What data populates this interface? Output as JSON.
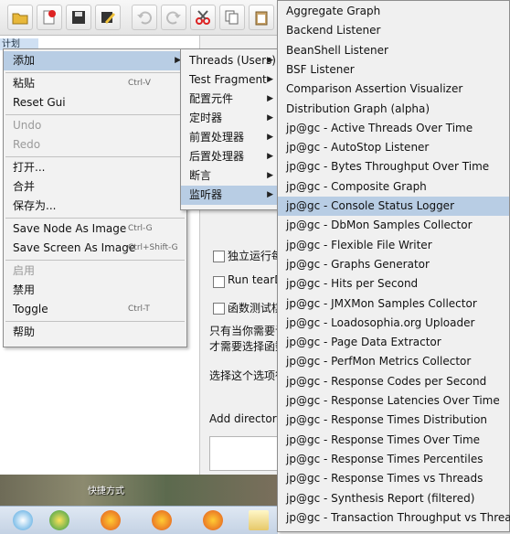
{
  "tree": {
    "selected_item": "计划"
  },
  "context_menu": {
    "items": [
      {
        "label": "添加",
        "shortcut": "",
        "submenu": true,
        "highlighted": true,
        "enabled": true
      },
      {
        "label": "粘贴",
        "shortcut": "Ctrl-V",
        "enabled": true
      },
      {
        "label": "Reset Gui",
        "shortcut": "",
        "enabled": true
      },
      {
        "label": "Undo",
        "shortcut": "",
        "enabled": false
      },
      {
        "label": "Redo",
        "shortcut": "",
        "enabled": false
      },
      {
        "label": "打开...",
        "shortcut": "",
        "enabled": true
      },
      {
        "label": "合并",
        "shortcut": "",
        "enabled": true
      },
      {
        "label": "保存为...",
        "shortcut": "",
        "enabled": true
      },
      {
        "label": "Save Node As Image",
        "shortcut": "Ctrl-G",
        "enabled": true
      },
      {
        "label": "Save Screen As Image",
        "shortcut": "Ctrl+Shift-G",
        "enabled": true
      },
      {
        "label": "启用",
        "shortcut": "",
        "enabled": false
      },
      {
        "label": "禁用",
        "shortcut": "",
        "enabled": true
      },
      {
        "label": "Toggle",
        "shortcut": "Ctrl-T",
        "enabled": true
      },
      {
        "label": "帮助",
        "shortcut": "",
        "enabled": true
      }
    ]
  },
  "add_submenu": {
    "items": [
      {
        "label": "Threads (Users)"
      },
      {
        "label": "Test Fragment"
      },
      {
        "label": "配置元件"
      },
      {
        "label": "定时器"
      },
      {
        "label": "前置处理器"
      },
      {
        "label": "后置处理器"
      },
      {
        "label": "断言"
      },
      {
        "label": "监听器",
        "highlighted": true
      }
    ]
  },
  "listener_menu": {
    "items": [
      "Aggregate Graph",
      "Backend Listener",
      "BeanShell Listener",
      "BSF Listener",
      "Comparison Assertion Visualizer",
      "Distribution Graph (alpha)",
      "jp@gc - Active Threads Over Time",
      "jp@gc - AutoStop Listener",
      "jp@gc - Bytes Throughput Over Time",
      "jp@gc - Composite Graph",
      "jp@gc - Console Status Logger",
      "jp@gc - DbMon Samples Collector",
      "jp@gc - Flexible File Writer",
      "jp@gc - Graphs Generator",
      "jp@gc - Hits per Second",
      "jp@gc - JMXMon Samples Collector",
      "jp@gc - Loadosophia.org Uploader",
      "jp@gc - Page Data Extractor",
      "jp@gc - PerfMon Metrics Collector",
      "jp@gc - Response Codes per Second",
      "jp@gc - Response Latencies Over Time",
      "jp@gc - Response Times Distribution",
      "jp@gc - Response Times Over Time",
      "jp@gc - Response Times Percentiles",
      "jp@gc - Response Times vs Threads",
      "jp@gc - Synthesis Report (filtered)",
      "jp@gc - Transaction Throughput vs Threads"
    ],
    "highlighted_index": 10
  },
  "right_pane": {
    "run_each_label": "独立运行每",
    "run_teardown_label": "Run tearDo",
    "functional_test_label": "函数测试棋",
    "info_line_1": "只有当你需要记",
    "info_line_2": "才需要选择函数",
    "info_line_3": "选择这个选项很",
    "add_directory_label": "Add directory o"
  },
  "desktop": {
    "shortcut_label": "快捷方式"
  },
  "colors": {
    "highlight": "#b8cde4",
    "menu_bg": "#f2f2f2"
  }
}
